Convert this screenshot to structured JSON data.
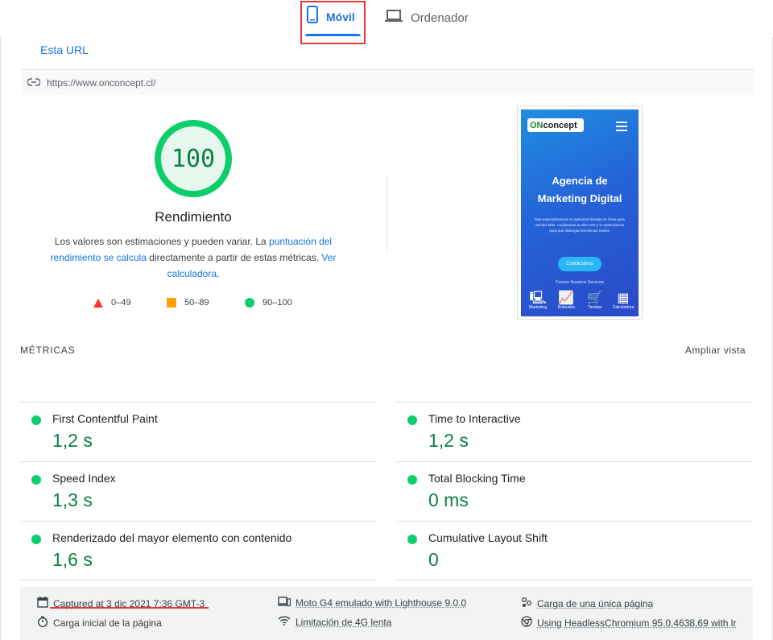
{
  "device_tabs": {
    "mobile_label": "Móvil",
    "desktop_label": "Ordenador"
  },
  "url_section": {
    "tab_label": "Esta URL",
    "url": "https://www.onconcept.cl/"
  },
  "score": {
    "value": "100",
    "title": "Rendimiento",
    "desc_part1": "Los valores son estimaciones y pueden variar. La ",
    "desc_link1": "puntuación del rendimiento se calcula",
    "desc_part2": " directamente a partir de estas métricas. ",
    "desc_link2": "Ver calculadora",
    "desc_part3": "."
  },
  "legend": {
    "fail": "0–49",
    "average": "50–89",
    "pass": "90–100"
  },
  "screenshot": {
    "logo_on": "ON",
    "logo_rest": "concept",
    "hero_line1": "Agencia de",
    "hero_line2": "Marketing Digital",
    "hero_sub": "Nos especializamos en optimizar tiendas en línea para Vender Más. Analizamos tu sitio web y lo optimizamos para que obtengas beneficios reales.",
    "cta": "Contáctanos",
    "cta_sub": "Conoce Nuestros Servicios",
    "icons": [
      "Marketing",
      "Embudos",
      "Tiendas",
      "Calculadora"
    ]
  },
  "metrics": {
    "label": "MÉTRICAS",
    "expand_label": "Ampliar vista",
    "items": [
      {
        "title": "First Contentful Paint",
        "value": "1,2 s"
      },
      {
        "title": "Time to Interactive",
        "value": "1,2 s"
      },
      {
        "title": "Speed Index",
        "value": "1,3 s"
      },
      {
        "title": "Total Blocking Time",
        "value": "0 ms"
      },
      {
        "title": "Renderizado del mayor elemento con contenido",
        "value": "1,6 s"
      },
      {
        "title": "Cumulative Layout Shift",
        "value": "0"
      }
    ]
  },
  "footer": {
    "captured": "Captured at 3 dic 2021 7:36 GMT-3",
    "initial_load": "Carga inicial de la página",
    "device": "Moto G4 emulado with Lighthouse 9.0.0",
    "throttling": "Limitación de 4G lenta",
    "single_load": "Carga de una única página",
    "browser": "Using HeadlessChromium 95.0.4638.69 with lr"
  },
  "colors": {
    "pass": "#0cce6b",
    "pass_text": "#0b8043",
    "average": "#ffa400",
    "fail": "#ff3333",
    "accent": "#1a73e8",
    "highlight": "#e53935"
  }
}
